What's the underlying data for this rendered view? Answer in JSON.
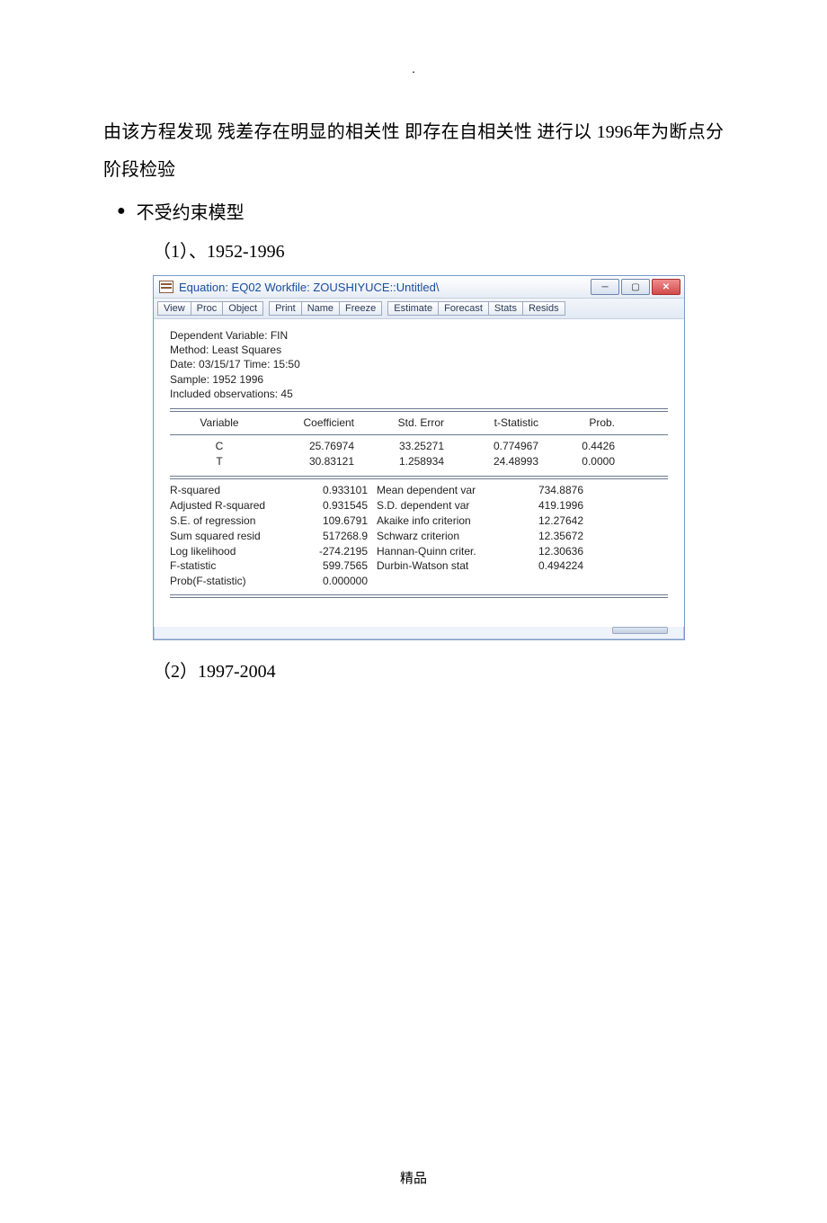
{
  "doc": {
    "paragraph": "由该方程发现 残差存在明显的相关性 即存在自相关性 进行以 1996年为断点分阶段检验",
    "bullet": "不受约束模型",
    "sub1": "（1）、1952-1996",
    "sub2": "（2）1997-2004",
    "footer": "精品"
  },
  "window": {
    "title": "Equation: EQ02   Workfile: ZOUSHIYUCE::Untitled\\",
    "toolbar": {
      "g1": [
        "View",
        "Proc",
        "Object"
      ],
      "g2": [
        "Print",
        "Name",
        "Freeze"
      ],
      "g3": [
        "Estimate",
        "Forecast",
        "Stats",
        "Resids"
      ]
    },
    "header": {
      "l1": "Dependent Variable: FIN",
      "l2": "Method: Least Squares",
      "l3": "Date: 03/15/17   Time: 15:50",
      "l4": "Sample: 1952 1996",
      "l5": "Included observations: 45"
    },
    "cols": {
      "c0": "Variable",
      "c1": "Coefficient",
      "c2": "Std. Error",
      "c3": "t-Statistic",
      "c4": "Prob."
    },
    "rows": [
      {
        "v": "C",
        "coef": "25.76974",
        "se": "33.25271",
        "t": "0.774967",
        "p": "0.4426"
      },
      {
        "v": "T",
        "coef": "30.83121",
        "se": "1.258934",
        "t": "24.48993",
        "p": "0.0000"
      }
    ],
    "stats": {
      "left": [
        {
          "label": "R-squared",
          "val": "0.933101"
        },
        {
          "label": "Adjusted R-squared",
          "val": "0.931545"
        },
        {
          "label": "S.E. of regression",
          "val": "109.6791"
        },
        {
          "label": "Sum squared resid",
          "val": "517268.9"
        },
        {
          "label": "Log likelihood",
          "val": "-274.2195"
        },
        {
          "label": "F-statistic",
          "val": "599.7565"
        },
        {
          "label": "Prob(F-statistic)",
          "val": "0.000000"
        }
      ],
      "right": [
        {
          "label": "Mean dependent var",
          "val": "734.8876"
        },
        {
          "label": "S.D. dependent var",
          "val": "419.1996"
        },
        {
          "label": "Akaike info criterion",
          "val": "12.27642"
        },
        {
          "label": "Schwarz criterion",
          "val": "12.35672"
        },
        {
          "label": "Hannan-Quinn criter.",
          "val": "12.30636"
        },
        {
          "label": "Durbin-Watson stat",
          "val": "0.494224"
        }
      ]
    }
  }
}
